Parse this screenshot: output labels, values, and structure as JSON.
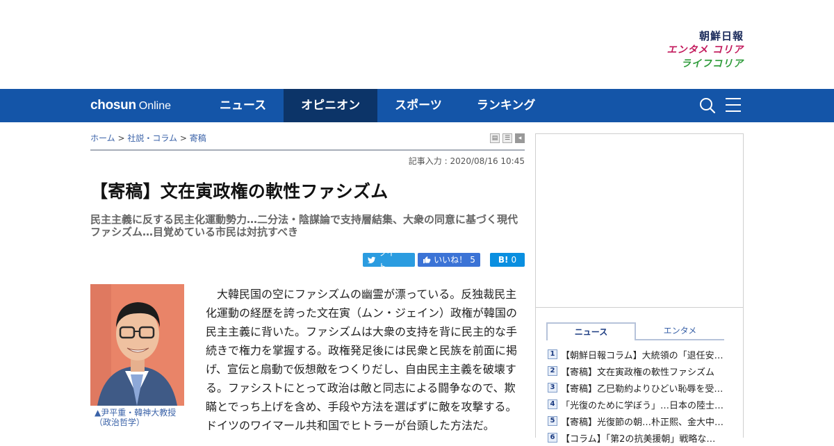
{
  "brands": {
    "chosun": "朝鮮日報",
    "entame": "エンタメ コリア",
    "life": "ライフコリア"
  },
  "nav": {
    "logo_bold": "chosun",
    "logo_light": "Online",
    "items": [
      {
        "label": "ニュース"
      },
      {
        "label": "オピニオン",
        "active": true
      },
      {
        "label": "スポーツ"
      },
      {
        "label": "ランキング"
      }
    ],
    "search_icon": "search-icon",
    "menu_icon": "hamburger-menu-icon"
  },
  "breadcrumb": {
    "home": "ホーム",
    "sep": ">",
    "section": "社説・コラム",
    "sub": "寄稿"
  },
  "article": {
    "date": "記事入力 : 2020/08/16 10:45",
    "headline": "【寄稿】文在寅政権の軟性ファシズム",
    "subhead": "民主主義に反する民主化運動勢力…二分法・陰謀論で支持層結集、大衆の同意に基づく現代ファシズム…目覚めている市民は対抗すべき",
    "photo_caption_1": "▲尹平重・韓神大教授",
    "photo_caption_2": "（政治哲学）",
    "body": "大韓民国の空にファシズムの幽霊が漂っている。反独裁民主化運動の経歴を誇った文在寅（ムン・ジェイン）政権が韓国の民主主義に背いた。ファシズムは大衆の支持を背に民主的な手続きで権力を掌握する。政権発足後には民衆と民族を前面に掲げ、宣伝と扇動で仮想敵をつくりだし、自由民主主義を破壊する。ファシストにとって政治は敵と同志による闘争なので、欺瞞とでっち上げを含め、手段や方法を選ばずに敵を攻撃する。ドイツのワイマール共和国でヒトラーが台頭した方法だ。"
  },
  "share": {
    "tweet": "ツイート",
    "like": "いいね！",
    "like_count": "5",
    "hatena": "B!",
    "hatena_count": "0"
  },
  "sidebar": {
    "tab_news": "ニュース",
    "tab_entame": "エンタメ",
    "ranking": [
      {
        "num": "1",
        "title": "【朝鮮日報コラム】大統領の「退任安…"
      },
      {
        "num": "2",
        "title": "【寄稿】文在寅政権の軟性ファシズム"
      },
      {
        "num": "3",
        "title": "【寄稿】乙巳勒約よりひどい恥辱を受…"
      },
      {
        "num": "4",
        "title": "「光復のために学ぼう」…日本の陸士…"
      },
      {
        "num": "5",
        "title": "【寄稿】光復節の朝…朴正熙、金大中…"
      },
      {
        "num": "6",
        "title": "【コラム】「第2の抗美援朝」戦略な…"
      }
    ]
  },
  "colors": {
    "navbar": "#1455a8",
    "nav_active": "#0c3468",
    "link": "#3a62a8",
    "twitter": "#2b9ce0",
    "facebook": "#3b73d6",
    "hatena": "#0a8fe0"
  }
}
